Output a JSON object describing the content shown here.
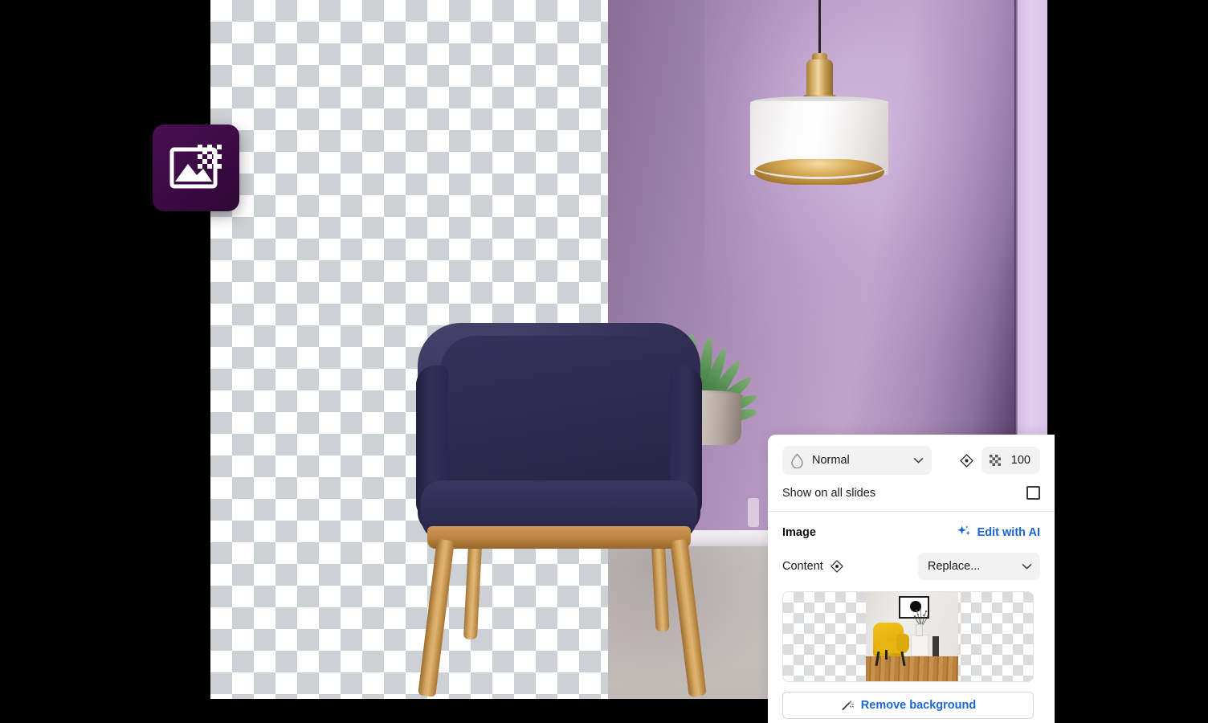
{
  "app_icon": {
    "name": "image-transparency-icon",
    "bg_color": "#3c0b45"
  },
  "canvas": {
    "name": "slide-canvas",
    "transparency_note": "checkerboard transparency",
    "scene": {
      "chair_color": "#2c2a4d",
      "wall_color": "#b495c0",
      "accent_wall_color": "#4a3259",
      "floor_color": "#c9c2bf"
    }
  },
  "panel": {
    "blend": {
      "icon": "droplet-icon",
      "value": "Normal",
      "chevron": "chevron-down-icon"
    },
    "opacity": {
      "keyframe_icon": "diamond-keyframe-icon",
      "transparency_icon": "checker-transparency-icon",
      "value": "100"
    },
    "show_on_all_slides": {
      "label": "Show on all slides",
      "checked": false
    },
    "image_section": {
      "title": "Image",
      "ai_button": {
        "label": "Edit with AI",
        "icon": "sparkles-icon",
        "color": "#1a66d6"
      }
    },
    "content": {
      "label": "Content",
      "keyframe_icon": "diamond-keyframe-icon",
      "replace": {
        "label": "Replace...",
        "chevron": "chevron-down-icon"
      }
    },
    "thumbnail": {
      "name": "image-thumbnail-preview",
      "alt": "yellow armchair in room"
    },
    "remove_background": {
      "label": "Remove background",
      "icon": "magic-wand-icon",
      "color": "#1a66d6"
    }
  }
}
